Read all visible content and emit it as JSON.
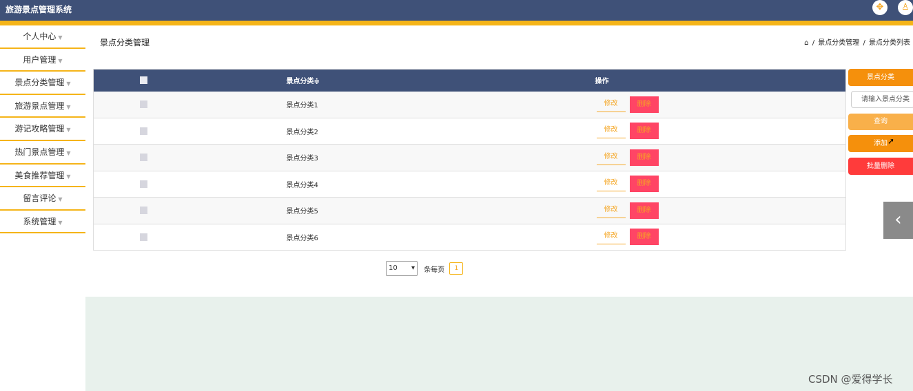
{
  "app": {
    "title": "旅游景点管理系统"
  },
  "sidebar": {
    "items": [
      {
        "label": "个人中心"
      },
      {
        "label": "用户管理"
      },
      {
        "label": "景点分类管理"
      },
      {
        "label": "旅游景点管理"
      },
      {
        "label": "游记攻略管理"
      },
      {
        "label": "热门景点管理"
      },
      {
        "label": "美食推荐管理"
      },
      {
        "label": "留言评论"
      },
      {
        "label": "系统管理"
      }
    ]
  },
  "page": {
    "title": "景点分类管理",
    "breadcrumb": [
      "景点分类管理",
      "景点分类列表"
    ]
  },
  "table": {
    "headers": {
      "category": "景点分类≑",
      "actions": "操作"
    },
    "rows": [
      {
        "category": "景点分类1"
      },
      {
        "category": "景点分类2"
      },
      {
        "category": "景点分类3"
      },
      {
        "category": "景点分类4"
      },
      {
        "category": "景点分类5"
      },
      {
        "category": "景点分类6"
      }
    ],
    "edit_label": "修改",
    "delete_label": "删除"
  },
  "search_panel": {
    "label": "景点分类",
    "input_placeholder": "请输入景点分类",
    "search_label": "查询",
    "add_label": "添加",
    "batch_delete_label": "批量删除"
  },
  "pagination": {
    "page_size": "10",
    "per_page_text": "条每页",
    "current_page": "1"
  },
  "watermark": "CSDN @爱得学长",
  "colors": {
    "header_bg": "#3f5178",
    "accent_yellow": "#f5b418",
    "orange": "#f5900c",
    "delete_red": "#ff4565"
  }
}
